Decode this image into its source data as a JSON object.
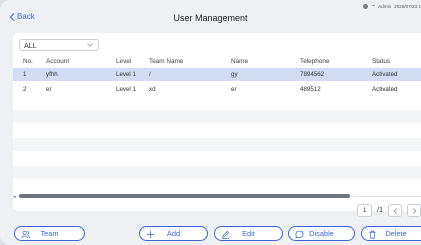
{
  "header": {
    "back_label": "Back",
    "title": "User Management",
    "user": "Admin",
    "datetime": "2025/07/23 1"
  },
  "filter": {
    "value": "ALL"
  },
  "table": {
    "columns": [
      "No.",
      "Account",
      "Level",
      "Team Name",
      "Name",
      "Telephone",
      "Status"
    ],
    "rows": [
      {
        "no": "1",
        "account": "yfhh",
        "level": "Level 1",
        "team": "/",
        "name": "gy",
        "telephone": "7894562",
        "status": "Activated"
      },
      {
        "no": "2",
        "account": "er",
        "level": "Level 1",
        "team": "xd",
        "name": "er",
        "telephone": "489512",
        "status": "Activated"
      }
    ]
  },
  "pager": {
    "current_page": "1",
    "total": "/1"
  },
  "buttons": {
    "team": "Team",
    "add": "Add",
    "edit": "Edit",
    "disable": "Disable",
    "delete": "Delete"
  },
  "colors": {
    "accent": "#3b66d9",
    "selected_row": "#cfdcf4"
  }
}
